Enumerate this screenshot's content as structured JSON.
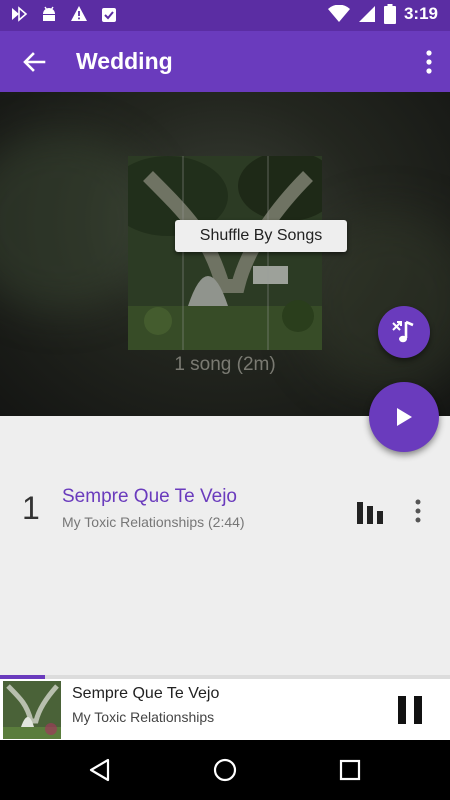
{
  "status_bar": {
    "time": "3:19",
    "left_icons": [
      "media-play-icon",
      "android-icon",
      "warning-icon",
      "clipboard-icon"
    ],
    "right_icons": [
      "wifi-icon",
      "signal-icon",
      "battery-icon"
    ]
  },
  "toolbar": {
    "title": "Wedding",
    "back_icon": "arrow-back-icon",
    "menu_icon": "more-vert-icon"
  },
  "playlist": {
    "song_count": "1 song (2m)",
    "tooltip": "Shuffle By Songs"
  },
  "tracks": [
    {
      "number": "1",
      "title": "Sempre Que Te Vejo",
      "subtitle": "My Toxic Relationships (2:44)",
      "playing": true
    }
  ],
  "now_playing": {
    "title": "Sempre Que Te Vejo",
    "subtitle": "My Toxic Relationships",
    "progress": 0.1
  },
  "colors": {
    "accent": "#6a3bbd",
    "status_bar": "#5b2da3",
    "background": "#eeeeee"
  }
}
